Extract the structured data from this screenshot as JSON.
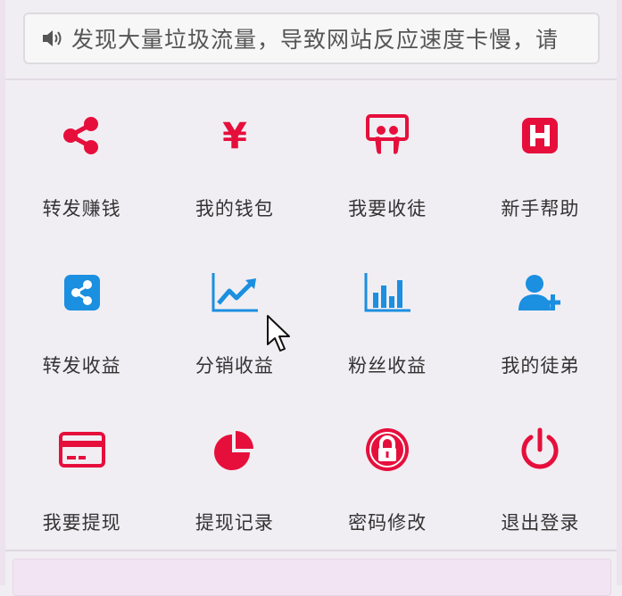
{
  "colors": {
    "red": "#e60f3c",
    "blue": "#1b8fe0",
    "text": "#333333",
    "notice_text": "#555555"
  },
  "notice": {
    "icon": "speaker-icon",
    "text": "发现大量垃圾流量，导致网站反应速度卡慢，请"
  },
  "menu": {
    "items": [
      {
        "label": "转发赚钱",
        "icon": "share-icon"
      },
      {
        "label": "我的钱包",
        "icon": "yen-icon"
      },
      {
        "label": "我要收徒",
        "icon": "slideshare-icon"
      },
      {
        "label": "新手帮助",
        "icon": "h-square-icon"
      },
      {
        "label": "转发收益",
        "icon": "share-square-icon"
      },
      {
        "label": "分销收益",
        "icon": "line-chart-icon"
      },
      {
        "label": "粉丝收益",
        "icon": "bar-chart-icon"
      },
      {
        "label": "我的徒弟",
        "icon": "user-plus-icon"
      },
      {
        "label": "我要提现",
        "icon": "credit-card-icon"
      },
      {
        "label": "提现记录",
        "icon": "pie-chart-icon"
      },
      {
        "label": "密码修改",
        "icon": "lock-icon"
      },
      {
        "label": "退出登录",
        "icon": "power-icon"
      }
    ]
  }
}
